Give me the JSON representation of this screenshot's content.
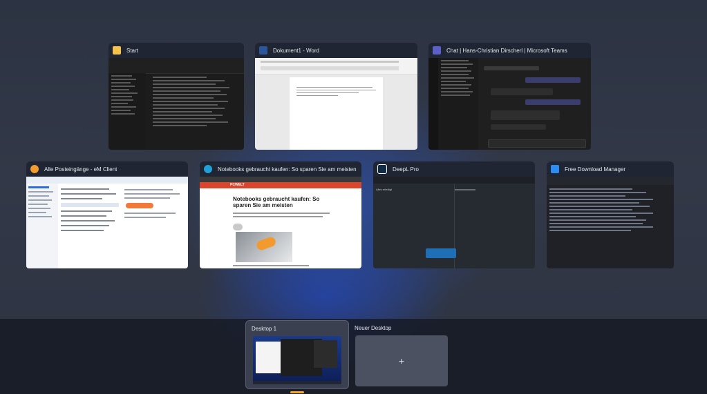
{
  "windows": [
    {
      "title": "Start",
      "icon": "file-explorer-icon",
      "icon_color": "#f5c24a"
    },
    {
      "title": "Dokument1 - Word",
      "icon": "word-icon",
      "icon_color": "#2b579a"
    },
    {
      "title": "Chat | Hans-Christian Dirscherl | Microsoft Teams",
      "icon": "teams-icon",
      "icon_color": "#5b5fc7"
    },
    {
      "title": "Alle Posteingänge - eM Client",
      "icon": "em-client-icon",
      "icon_color": "#f29b2f"
    },
    {
      "title": "Notebooks gebraucht kaufen: So sparen Sie am meisten - PC...",
      "icon": "edge-icon",
      "icon_color": "#1fa0d8"
    },
    {
      "title": "DeepL Pro",
      "icon": "deepl-icon",
      "icon_color": "#0f2b46"
    },
    {
      "title": "Free Download Manager",
      "icon": "fdm-icon",
      "icon_color": "#2c8cf0"
    }
  ],
  "article": {
    "brand": "PCWELT",
    "headline": "Notebooks gebraucht kaufen: So sparen Sie am meisten"
  },
  "deepl": {
    "label": "Alles erledigt"
  },
  "desktops": [
    {
      "label": "Desktop 1"
    },
    {
      "label": "Neuer Desktop",
      "add_symbol": "+"
    }
  ],
  "colors": {
    "accent": "#f5a623",
    "panel": "#1f2533"
  }
}
